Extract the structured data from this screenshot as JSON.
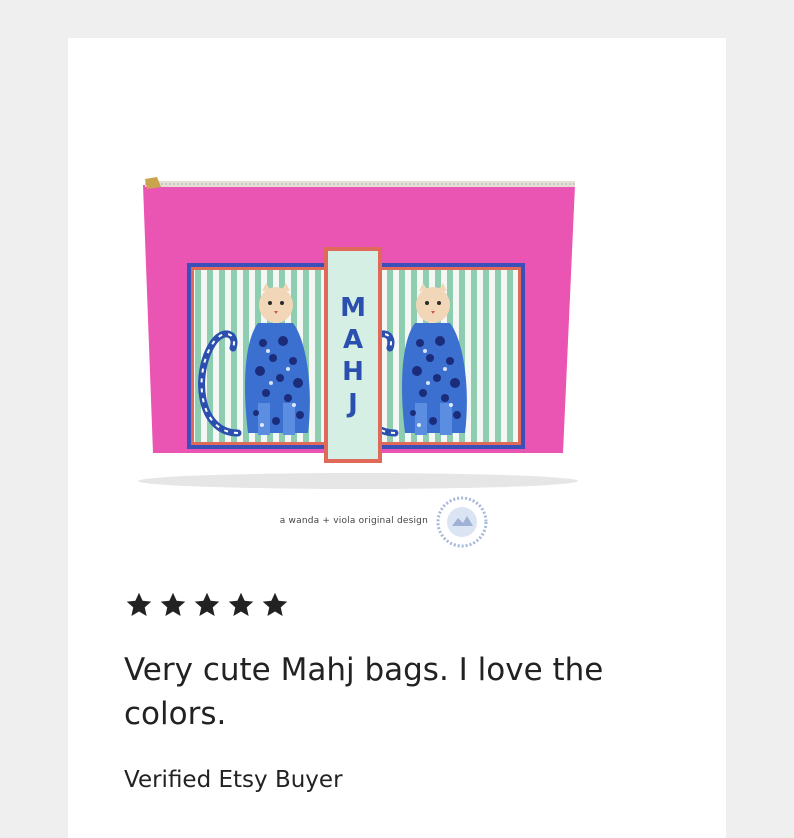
{
  "product": {
    "image_alt": "Pink zipper pouch with two blue leopards on green and white stripes and a vertical MAHJ panel",
    "panel_text": "MAHJ",
    "colors": {
      "bag_pink": "#ea55b3",
      "stripe_green": "#8fcdb0",
      "frame_blue": "#3a4fb8",
      "panel_mint": "#d6efe4",
      "panel_border": "#e06a5a",
      "leopard_blue": "#2a4fae",
      "zipper_gold": "#c9a44c"
    }
  },
  "credit": {
    "text": "a wanda + viola original design",
    "seal_icon": "brand-seal-icon"
  },
  "review": {
    "rating": 5,
    "star_icon": "star-icon",
    "text": "Very cute Mahj bags. I love the colors.",
    "reviewer": "Verified Etsy Buyer"
  }
}
